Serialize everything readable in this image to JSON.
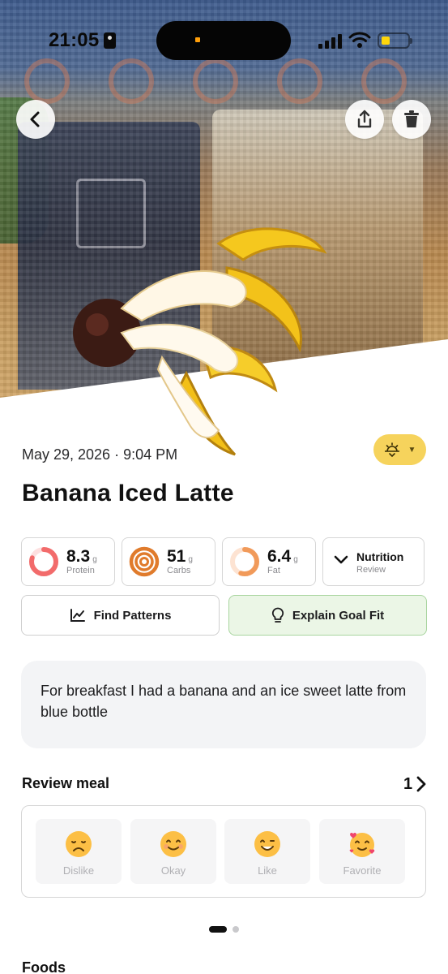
{
  "status_bar": {
    "time": "21:05"
  },
  "header": {
    "back_label": "Back",
    "share_label": "Share",
    "delete_label": "Delete"
  },
  "meal": {
    "datetime": "May 29, 2026 · 9:04 PM",
    "meal_type_icon": "sunrise-icon",
    "title": "Banana Iced Latte"
  },
  "macros": {
    "protein": {
      "value": "8.3",
      "unit": "g",
      "label": "Protein",
      "progress": 0.8,
      "color": "#f26b6b"
    },
    "carbs": {
      "value": "51",
      "unit": "g",
      "label": "Carbs",
      "progress": 1.0,
      "color": "#e07b2c"
    },
    "fat": {
      "value": "6.4",
      "unit": "g",
      "label": "Fat",
      "progress": 0.55,
      "color": "#f19a5a"
    },
    "nutrition": {
      "title": "Nutrition",
      "subtitle": "Review"
    }
  },
  "actions": {
    "find_patterns": "Find Patterns",
    "explain_goal_fit": "Explain Goal Fit"
  },
  "note": {
    "text": "For breakfast I had a banana and an ice sweet latte from blue bottle"
  },
  "review": {
    "title": "Review meal",
    "count": "1",
    "options": [
      {
        "label": "Dislike",
        "icon": "sad-face-icon"
      },
      {
        "label": "Okay",
        "icon": "smile-face-icon"
      },
      {
        "label": "Like",
        "icon": "happy-face-icon"
      },
      {
        "label": "Favorite",
        "icon": "hearts-face-icon"
      }
    ]
  },
  "pager": {
    "current": 1,
    "total": 2
  },
  "foods": {
    "title": "Foods"
  },
  "colors": {
    "accent_yellow": "#f6d35c",
    "goal_green_bg": "#ebf6e6",
    "goal_green_border": "#a9d5a0"
  }
}
